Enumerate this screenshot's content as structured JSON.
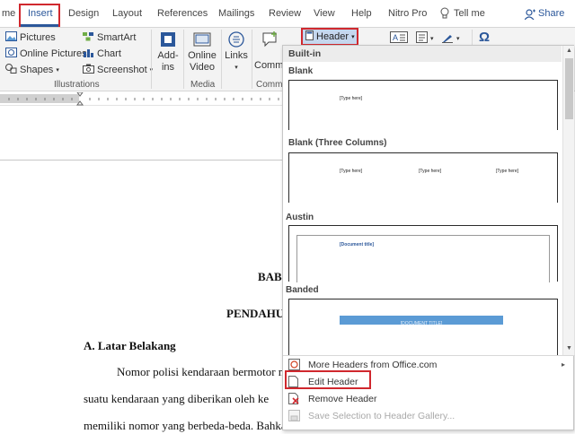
{
  "tabs": {
    "home_partial": "me",
    "insert": "Insert",
    "design": "Design",
    "layout": "Layout",
    "references": "References",
    "mailings": "Mailings",
    "review": "Review",
    "view": "View",
    "help": "Help",
    "nitro": "Nitro Pro",
    "tell_me": "Tell me",
    "share": "Share"
  },
  "ribbon": {
    "pictures": "Pictures",
    "online_pictures": "Online Pictures",
    "shapes": "Shapes",
    "smartart": "SmartArt",
    "chart": "Chart",
    "screenshot": "Screenshot",
    "illustrations_group": "Illustrations",
    "addins_line1": "Add-",
    "addins_line2": "ins",
    "online_video_line1": "Online",
    "online_video_line2": "Video",
    "media_group": "Media",
    "links": "Links",
    "comment_partial": "Comme",
    "comments_group_partial": "Comme",
    "header_button": "Header",
    "omega_symbol": "Ω"
  },
  "dropdown": {
    "section_title": "Built-in",
    "items": [
      {
        "label": "Blank",
        "placeholders": [
          "[Type here]"
        ]
      },
      {
        "label": "Blank (Three Columns)",
        "placeholders": [
          "[Type here]",
          "[Type here]",
          "[Type here]"
        ]
      },
      {
        "label": "Austin",
        "placeholders": [
          "[Document title]"
        ]
      },
      {
        "label": "Banded",
        "placeholders": [
          "[DOCUMENT TITLE]"
        ]
      }
    ],
    "menu": {
      "more_headers": "More Headers from Office.com",
      "edit_header": "Edit Header",
      "remove_header": "Remove Header",
      "save_selection": "Save Selection to Header Gallery..."
    }
  },
  "document": {
    "chapter": "BAB",
    "chapter_title": "PENDAHU",
    "section_heading": "A. Latar Belakang",
    "para_line1": "Nomor polisi kendaraan bermotor m",
    "para_line2": "suatu  kendaraan  yang  diberikan  oleh  ke",
    "para_line3": "memiliki nomor yang berbeda-beda. Bahka"
  },
  "colors": {
    "accent": "#2b579a",
    "highlight_border": "#d0282e",
    "header_button_bg": "#c5d7ee",
    "banded_bar": "#5b9bd5"
  }
}
